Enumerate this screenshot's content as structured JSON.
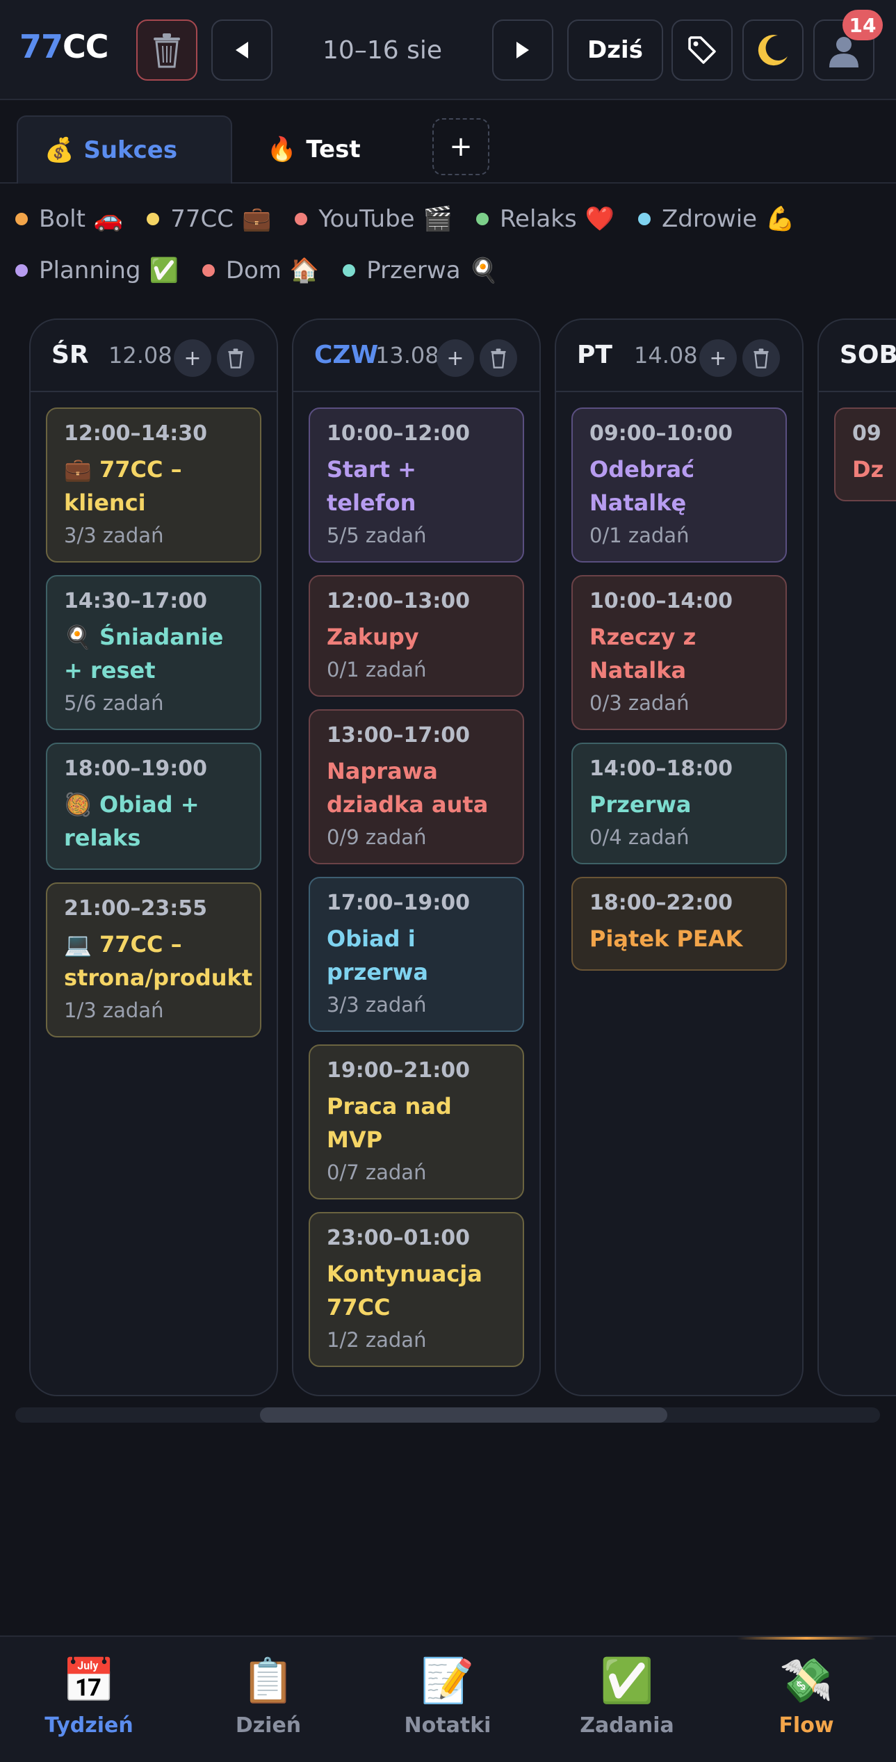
{
  "header": {
    "logo_part1": "77",
    "logo_part2": "CC",
    "date_range": "10–16 sie",
    "today_label": "Dziś",
    "notification_count": "14",
    "icons": [
      "trash-icon",
      "arrow-left-icon",
      "arrow-right-icon",
      "tag-icon",
      "moon-icon",
      "user-avatar-icon"
    ]
  },
  "tabs": [
    {
      "emoji": "💰",
      "label": "Sukces",
      "active": true
    },
    {
      "emoji": "🔥",
      "label": "Test",
      "active": false
    }
  ],
  "add_tab_label": "+",
  "legend": [
    {
      "label": "Bolt",
      "emoji": "🚗",
      "color": "#f3a54a"
    },
    {
      "label": "77CC",
      "emoji": "💼",
      "color": "#f5d565"
    },
    {
      "label": "YouTube",
      "emoji": "🎬",
      "color": "#f07f7a"
    },
    {
      "label": "Relaks",
      "emoji": "❤️",
      "color": "#7ccf8a"
    },
    {
      "label": "Zdrowie",
      "emoji": "💪",
      "color": "#7fd3f0"
    },
    {
      "label": "Planning",
      "emoji": "✅",
      "color": "#b79cf0"
    },
    {
      "label": "Dom",
      "emoji": "🏠",
      "color": "#f07f7a"
    },
    {
      "label": "Przerwa",
      "emoji": "🍳",
      "color": "#7ddccf"
    }
  ],
  "columns": [
    {
      "day": "ŚR",
      "date": "12.08",
      "current": false,
      "blocks": [
        {
          "time": "12:00–14:30",
          "title": "💼 77CC – klienci",
          "count": "3/3 zadań",
          "category": "77cc"
        },
        {
          "time": "14:30–17:00",
          "title": "🍳 Śniadanie + reset",
          "count": "5/6 zadań",
          "category": "przerwa"
        },
        {
          "time": "18:00–19:00",
          "title": "🥘 Obiad + relaks",
          "count": "",
          "category": "przerwa"
        },
        {
          "time": "21:00–23:55",
          "title": "💻 77CC – strona/produkt",
          "count": "1/3 zadań",
          "category": "77cc"
        }
      ]
    },
    {
      "day": "CZW",
      "date": "13.08",
      "current": true,
      "blocks": [
        {
          "time": "10:00–12:00",
          "title": "Start + telefon",
          "count": "5/5 zadań",
          "category": "planning"
        },
        {
          "time": "12:00–13:00",
          "title": "Zakupy",
          "count": "0/1 zadań",
          "category": "dom"
        },
        {
          "time": "13:00–17:00",
          "title": "Naprawa dziadka auta",
          "count": "0/9 zadań",
          "category": "dom"
        },
        {
          "time": "17:00–19:00",
          "title": "Obiad i przerwa",
          "count": "3/3 zadań",
          "category": "zdrowie"
        },
        {
          "time": "19:00–21:00",
          "title": "Praca nad MVP",
          "count": "0/7 zadań",
          "category": "77cc"
        },
        {
          "time": "23:00–01:00",
          "title": "Kontynuacja 77CC",
          "count": "1/2 zadań",
          "category": "77cc"
        }
      ]
    },
    {
      "day": "PT",
      "date": "14.08",
      "current": false,
      "blocks": [
        {
          "time": "09:00–10:00",
          "title": "Odebrać Natalkę",
          "count": "0/1 zadań",
          "category": "planning"
        },
        {
          "time": "10:00–14:00",
          "title": "Rzeczy z Natalka",
          "count": "0/3 zadań",
          "category": "dom"
        },
        {
          "time": "14:00–18:00",
          "title": "Przerwa",
          "count": "0/4 zadań",
          "category": "przerwa"
        },
        {
          "time": "18:00–22:00",
          "title": "Piątek PEAK",
          "count": "",
          "category": "bolt"
        }
      ]
    },
    {
      "day": "SOB",
      "date": "",
      "current": false,
      "blocks": [
        {
          "time": "09",
          "title": "Dz",
          "count": "",
          "category": "dom"
        }
      ]
    }
  ],
  "bottom_nav": [
    {
      "label": "Tydzień",
      "icon": "calendar-icon",
      "glyph": "📅",
      "active": true
    },
    {
      "label": "Dzień",
      "icon": "clipboard-icon",
      "glyph": "📋",
      "active": false
    },
    {
      "label": "Notatki",
      "icon": "memo-icon",
      "glyph": "📝",
      "active": false
    },
    {
      "label": "Zadania",
      "icon": "checkmark-icon",
      "glyph": "✅",
      "active": false
    },
    {
      "label": "Flow",
      "icon": "money-wings-icon",
      "glyph": "💸",
      "active": false
    }
  ]
}
